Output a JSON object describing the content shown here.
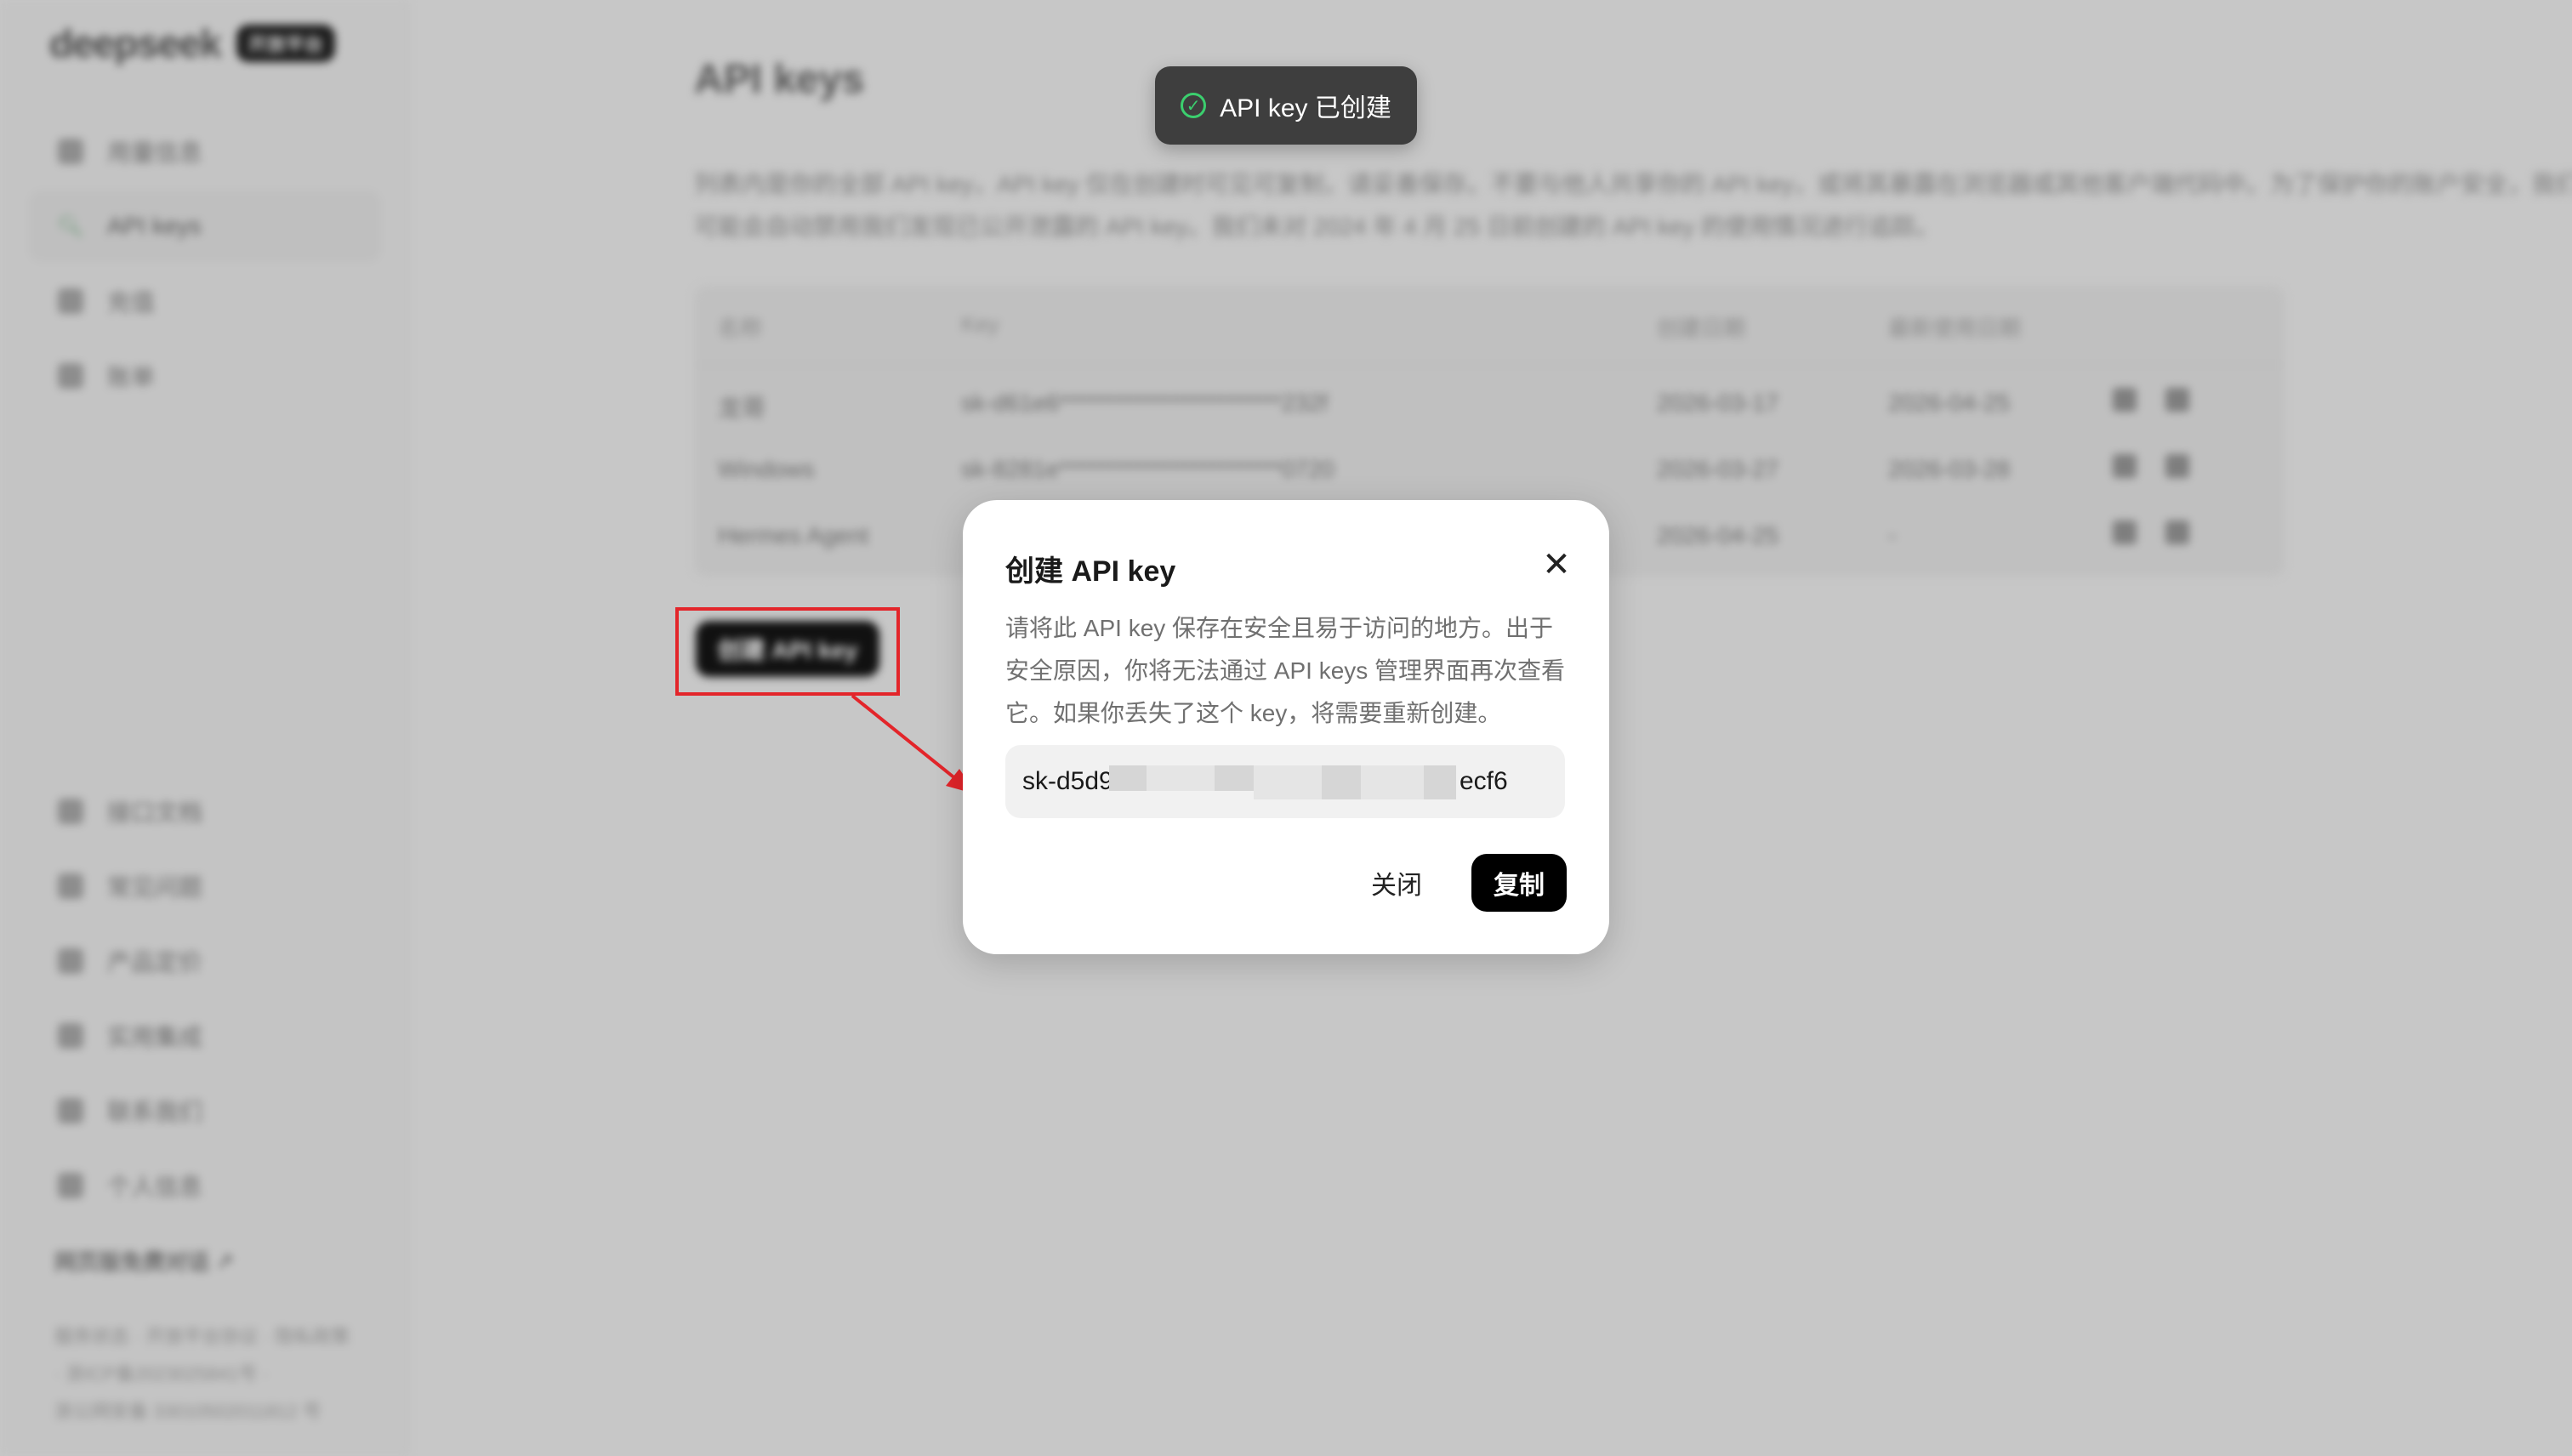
{
  "sidebar": {
    "logo": "deepseek",
    "badge": "开放平台",
    "items": [
      {
        "label": "用量信息",
        "icon": "bar-chart-icon"
      },
      {
        "label": "API keys",
        "icon": "search-icon",
        "active": true
      },
      {
        "label": "充值",
        "icon": "wallet-icon"
      },
      {
        "label": "账单",
        "icon": "receipt-icon"
      },
      {
        "label": "接口文档",
        "icon": "document-icon"
      },
      {
        "label": "常见问题",
        "icon": "question-icon"
      },
      {
        "label": "产品定价",
        "icon": "tag-icon"
      },
      {
        "label": "实用集成",
        "icon": "integration-icon"
      },
      {
        "label": "联系我们",
        "icon": "paper-plane-icon"
      },
      {
        "label": "个人信息",
        "icon": "user-icon"
      }
    ],
    "webchat": "网页版免费对话 ↗",
    "footer": [
      "服务状态 · 开放平台协议 · 隐私政策",
      "· 浙ICP备2023025841号 ·",
      "浙公网安备 33010502011812 号"
    ]
  },
  "main": {
    "title": "API keys",
    "desc": "列表内是你的全部 API key，API key 仅在创建时可见可复制，请妥善保存。不要与他人共享你的 API key，或将其暴露在浏览器或其他客户端代码中。为了保护你的账户安全，我们可能会自动禁用我们发现已公开泄露的 API key。我们未对 2024 年 4 月 25 日前创建的 API key 的使用情况进行追踪。",
    "columns": [
      "名称",
      "Key",
      "创建日期",
      "最新使用日期"
    ],
    "rows": [
      {
        "name": "龙哥",
        "key": "sk-d61e6************************232f",
        "created": "2026-03-17",
        "last_used": "2026-04-25"
      },
      {
        "name": "Windows",
        "key": "sk-8281e************************0720",
        "created": "2026-03-27",
        "last_used": "2026-03-28"
      },
      {
        "name": "Hermes Agent",
        "key": "",
        "created": "2026-04-25",
        "last_used": "-"
      }
    ],
    "create_button": "创建 API key"
  },
  "toast": {
    "text": "API key 已创建"
  },
  "modal": {
    "title": "创建 API key",
    "desc": "请将此 API key 保存在安全且易于访问的地方。出于安全原因，你将无法通过 API keys 管理界面再次查看它。如果你丢失了这个 key，将需要重新创建。",
    "key_prefix": "sk-d5d9",
    "key_suffix": "ecf6",
    "close_label": "关闭",
    "copy_label": "复制"
  },
  "colors": {
    "highlight": "#e3252a",
    "toast_check": "#3bcf6e"
  }
}
